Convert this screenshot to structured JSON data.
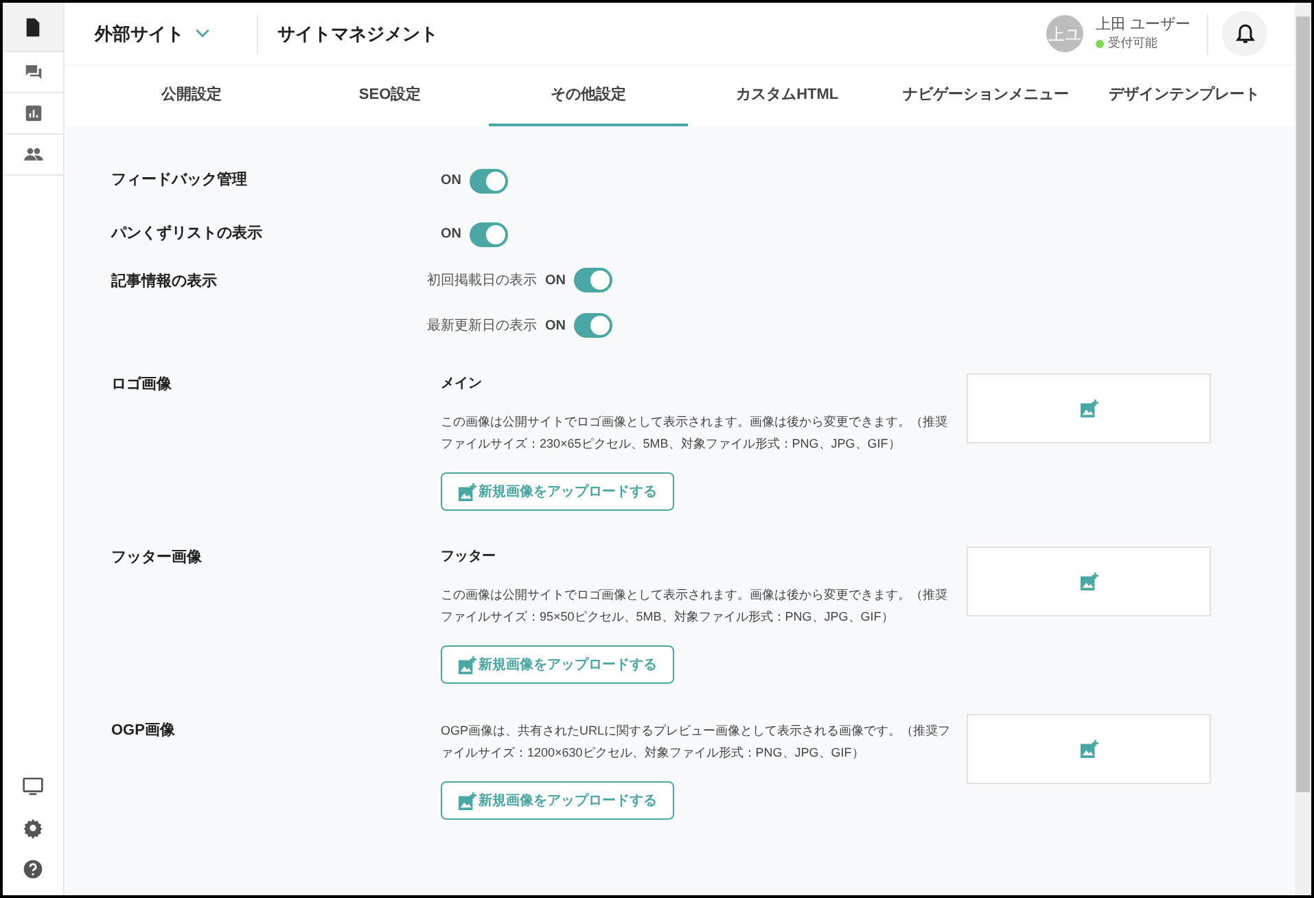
{
  "sidebar": {
    "items": [
      {
        "kind": "document",
        "selected": true
      },
      {
        "kind": "chat",
        "selected": false
      },
      {
        "kind": "chart",
        "selected": false
      },
      {
        "kind": "people",
        "selected": false
      }
    ],
    "bottom_items": [
      {
        "kind": "monitor"
      },
      {
        "kind": "settings"
      },
      {
        "kind": "help"
      }
    ]
  },
  "header": {
    "site_selector": "外部サイト",
    "title": "サイトマネジメント",
    "user": {
      "initials": "上ユ",
      "name": "上田 ユーザー",
      "status": "受付可能"
    }
  },
  "tabs": [
    {
      "label": "公開設定",
      "selected": false
    },
    {
      "label": "SEO設定",
      "selected": false
    },
    {
      "label": "その他設定",
      "selected": true
    },
    {
      "label": "カスタムHTML",
      "selected": false
    },
    {
      "label": "ナビゲーションメニュー",
      "selected": false
    },
    {
      "label": "デザインテンプレート",
      "selected": false
    }
  ],
  "settings": [
    {
      "kind": "toggle",
      "label": "フィードバック管理",
      "state_label": "ON",
      "on": true
    },
    {
      "kind": "toggle",
      "label": "パンくずリストの表示",
      "state_label": "ON",
      "on": true
    },
    {
      "kind": "sub_toggles",
      "label": "記事情報の表示",
      "toggles": [
        {
          "label": "初回掲載日の表示",
          "state_label": "ON",
          "on": true
        },
        {
          "label": "最新更新日の表示",
          "state_label": "ON",
          "on": true
        }
      ]
    },
    {
      "kind": "image",
      "label": "ロゴ画像",
      "subtitle": "メイン",
      "description": "この画像は公開サイトでロゴ画像として表示されます。画像は後から変更できます。（推奨ファイルサイズ：230×65ピクセル、5MB、対象ファイル形式：PNG、JPG、GIF）",
      "button": "新規画像をアップロードする"
    },
    {
      "kind": "image",
      "label": "フッター画像",
      "subtitle": "フッター",
      "description": "この画像は公開サイトでロゴ画像として表示されます。画像は後から変更できます。（推奨ファイルサイズ：95×50ピクセル、5MB、対象ファイル形式：PNG、JPG、GIF）",
      "button": "新規画像をアップロードする"
    },
    {
      "kind": "image",
      "label": "OGP画像",
      "description": "OGP画像は、共有されたURLに関するプレビュー画像として表示される画像です。（推奨ファイルサイズ：1200×630ピクセル、対象ファイル形式：PNG、JPG、GIF）",
      "button": "新規画像をアップロードする"
    }
  ]
}
